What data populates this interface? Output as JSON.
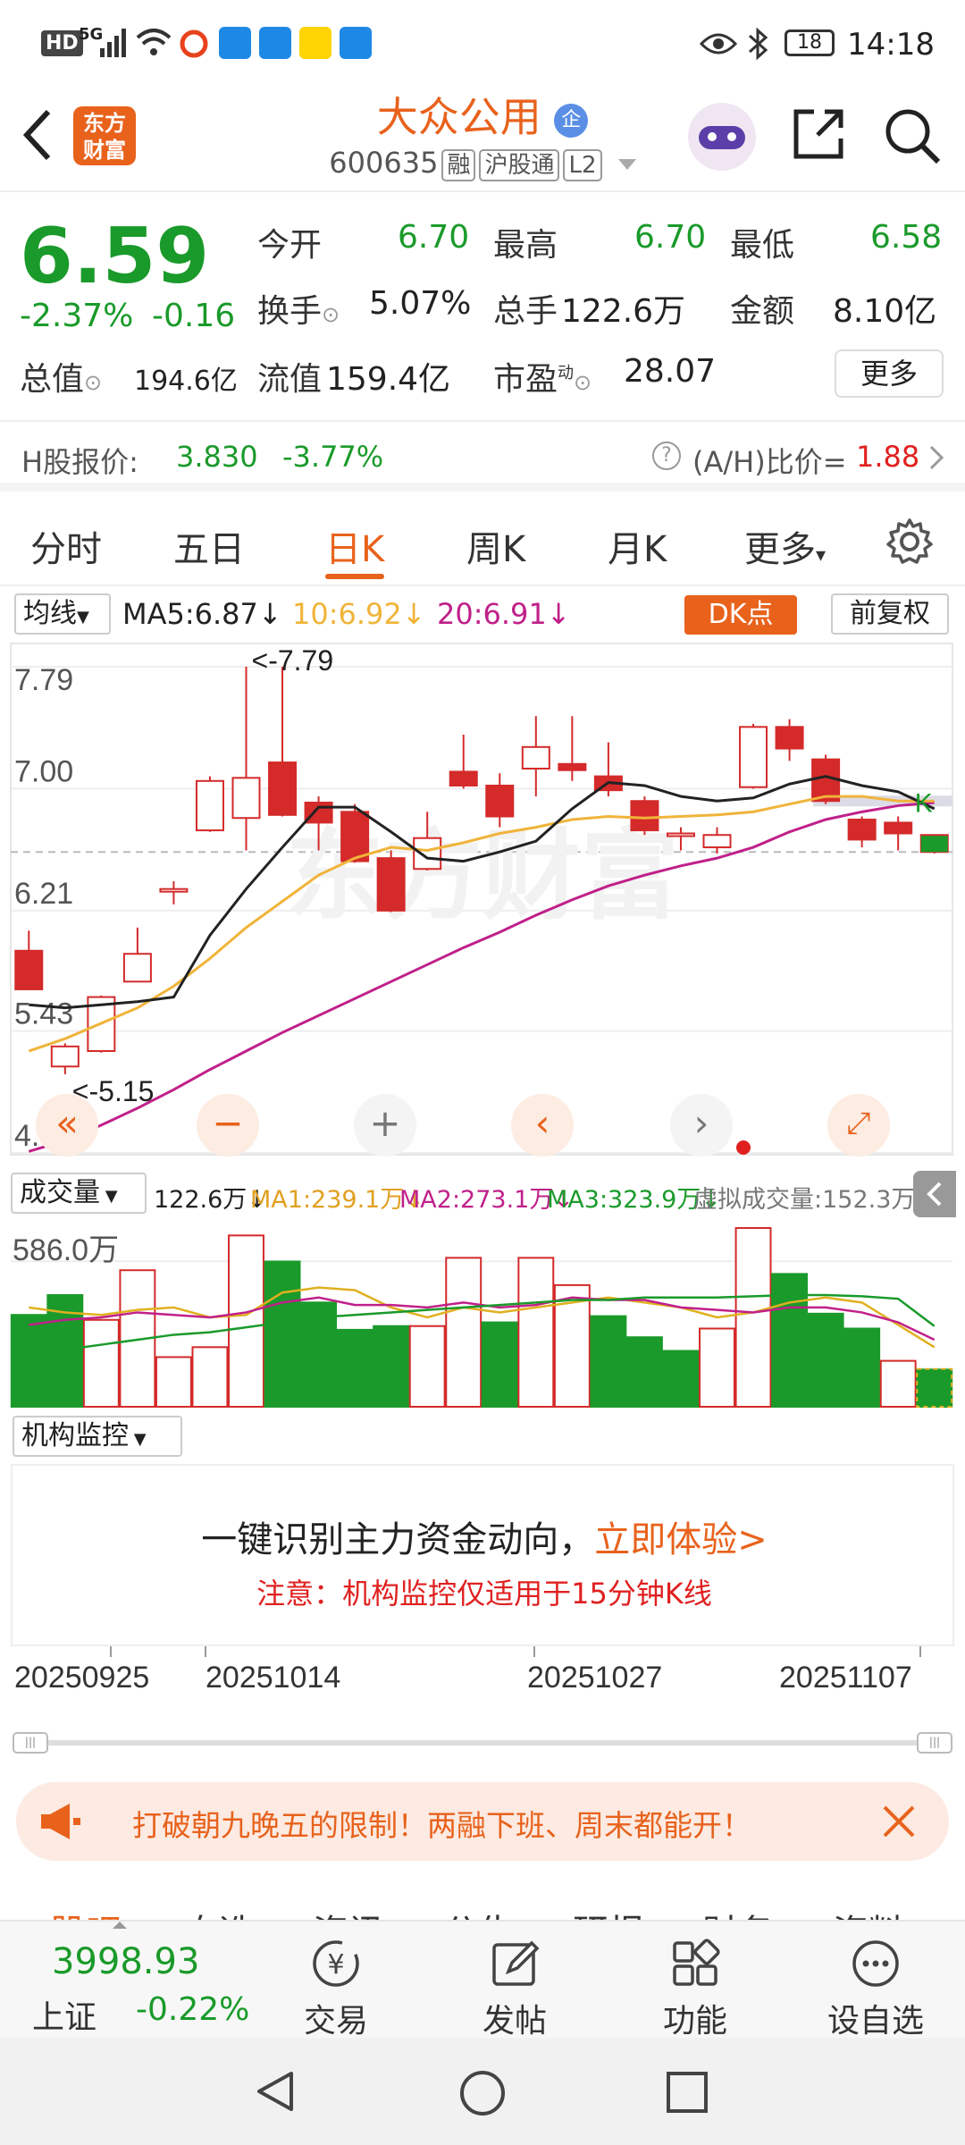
{
  "status_bar": {
    "left": "HD",
    "net": "5G",
    "battery": "18",
    "time": "14:18"
  },
  "header": {
    "logo_text": "东方\n财富",
    "stock_name": "大众公用",
    "enterprise_badge": "企",
    "code": "600635",
    "tags": [
      "融",
      "沪股通",
      "L2"
    ]
  },
  "quote": {
    "price": "6.59",
    "change_pct": "-2.37%",
    "change_abs": "-0.16",
    "open_label": "今开",
    "open": "6.70",
    "high_label": "最高",
    "high": "6.70",
    "low_label": "最低",
    "low": "6.58",
    "turnover_label": "换手",
    "turnover": "5.07%",
    "volume_label": "总手",
    "volume": "122.6万",
    "amount_label": "金额",
    "amount": "8.10亿",
    "mcap_label": "总值",
    "mcap": "194.6亿",
    "float_label": "流值",
    "float_cap": "159.4亿",
    "pe_label": "市盈",
    "pe_super": "动",
    "pe": "28.07",
    "more_button": "更多"
  },
  "hshare": {
    "label": "H股报价:",
    "price": "3.830",
    "change": "-3.77%",
    "ah_label": "(A/H)比价=",
    "ah_value": "1.88"
  },
  "tabs": [
    "分时",
    "五日",
    "日K",
    "周K",
    "月K",
    "更多"
  ],
  "active_tab": "日K",
  "ma_bar": {
    "selector": "均线",
    "ma5": "MA5:6.87",
    "ma10": "10:6.92",
    "ma20": "20:6.91",
    "dk_button": "DK点",
    "fq_button": "前复权"
  },
  "chart_data": {
    "type": "candlestick",
    "y_ticks": [
      "7.79",
      "7.00",
      "6.21",
      "5.43",
      "4.64"
    ],
    "ylim": [
      4.64,
      7.79
    ],
    "high_annotation": "<-7.79",
    "low_annotation": "<-5.15",
    "candles": [
      {
        "o": 5.95,
        "c": 5.7,
        "h": 6.08,
        "l": 5.7
      },
      {
        "o": 5.2,
        "c": 5.33,
        "h": 5.35,
        "l": 5.15
      },
      {
        "o": 5.3,
        "c": 5.65,
        "h": 5.66,
        "l": 5.29
      },
      {
        "o": 5.75,
        "c": 5.93,
        "h": 6.1,
        "l": 5.75
      },
      {
        "o": 6.35,
        "c": 6.35,
        "h": 6.4,
        "l": 6.25
      },
      {
        "o": 6.73,
        "c": 7.05,
        "h": 7.08,
        "l": 6.72
      },
      {
        "o": 6.81,
        "c": 7.07,
        "h": 7.79,
        "l": 6.6
      },
      {
        "o": 7.17,
        "c": 6.83,
        "h": 7.79,
        "l": 6.82
      },
      {
        "o": 6.91,
        "c": 6.78,
        "h": 6.95,
        "l": 6.6
      },
      {
        "o": 6.85,
        "c": 6.53,
        "h": 6.9,
        "l": 6.52
      },
      {
        "o": 6.55,
        "c": 6.21,
        "h": 6.6,
        "l": 6.2
      },
      {
        "o": 6.48,
        "c": 6.68,
        "h": 6.85,
        "l": 6.47
      },
      {
        "o": 7.11,
        "c": 7.02,
        "h": 7.35,
        "l": 7.0
      },
      {
        "o": 7.02,
        "c": 6.82,
        "h": 7.1,
        "l": 6.75
      },
      {
        "o": 7.13,
        "c": 7.27,
        "h": 7.47,
        "l": 6.95
      },
      {
        "o": 7.16,
        "c": 7.12,
        "h": 7.47,
        "l": 7.05
      },
      {
        "o": 7.08,
        "c": 6.99,
        "h": 7.3,
        "l": 6.95
      },
      {
        "o": 6.92,
        "c": 6.73,
        "h": 6.95,
        "l": 6.7
      },
      {
        "o": 6.7,
        "c": 6.71,
        "h": 6.75,
        "l": 6.6
      },
      {
        "o": 6.62,
        "c": 6.7,
        "h": 6.75,
        "l": 6.58
      },
      {
        "o": 7.01,
        "c": 7.4,
        "h": 7.42,
        "l": 7.0
      },
      {
        "o": 7.4,
        "c": 7.26,
        "h": 7.45,
        "l": 7.18
      },
      {
        "o": 7.19,
        "c": 6.92,
        "h": 7.22,
        "l": 6.9
      },
      {
        "o": 6.8,
        "c": 6.67,
        "h": 6.82,
        "l": 6.62
      },
      {
        "o": 6.78,
        "c": 6.71,
        "h": 6.82,
        "l": 6.6
      },
      {
        "o": 6.7,
        "c": 6.59,
        "h": 6.7,
        "l": 6.58
      }
    ],
    "ma5": [
      5.6,
      5.58,
      5.6,
      5.62,
      5.65,
      6.05,
      6.35,
      6.62,
      6.88,
      6.88,
      6.72,
      6.55,
      6.53,
      6.59,
      6.66,
      6.87,
      7.04,
      7.02,
      6.95,
      6.92,
      6.94,
      7.03,
      7.08,
      7.02,
      6.98,
      6.87
    ],
    "ma10": [
      5.3,
      5.38,
      5.48,
      5.58,
      5.72,
      5.9,
      6.1,
      6.27,
      6.44,
      6.55,
      6.62,
      6.6,
      6.65,
      6.71,
      6.75,
      6.8,
      6.82,
      6.81,
      6.82,
      6.83,
      6.85,
      6.9,
      6.95,
      6.95,
      6.92,
      6.92
    ],
    "ma20": [
      4.65,
      4.72,
      4.82,
      4.93,
      5.05,
      5.18,
      5.3,
      5.42,
      5.53,
      5.64,
      5.75,
      5.86,
      5.97,
      6.07,
      6.18,
      6.28,
      6.37,
      6.44,
      6.5,
      6.55,
      6.62,
      6.72,
      6.8,
      6.85,
      6.89,
      6.91
    ],
    "volume_label": "成交量",
    "volume_max_tick": "586.0万",
    "volume_legend": {
      "vol": "122.6万",
      "ma1": "MA1:239.1万",
      "ma2": "MA2:273.1万",
      "ma3": "MA3:323.9万",
      "virtual": "虚拟成交量:152.3万"
    },
    "volumes": [
      370,
      450,
      350,
      550,
      200,
      240,
      690,
      585,
      420,
      310,
      325,
      325,
      600,
      340,
      600,
      490,
      365,
      280,
      225,
      315,
      720,
      535,
      375,
      315,
      185,
      150
    ],
    "volume_up": [
      false,
      false,
      true,
      true,
      true,
      true,
      true,
      false,
      false,
      false,
      false,
      true,
      true,
      false,
      true,
      true,
      false,
      false,
      false,
      true,
      true,
      false,
      false,
      false,
      true,
      false
    ],
    "vol_ma1": [
      400,
      380,
      370,
      390,
      400,
      360,
      370,
      460,
      480,
      470,
      400,
      360,
      400,
      380,
      400,
      420,
      440,
      420,
      400,
      360,
      380,
      420,
      440,
      420,
      330,
      240
    ],
    "vol_ma2": [
      330,
      350,
      360,
      380,
      370,
      360,
      380,
      420,
      440,
      410,
      410,
      400,
      420,
      400,
      410,
      440,
      430,
      430,
      400,
      390,
      380,
      400,
      400,
      380,
      340,
      270
    ],
    "vol_ma3": [
      210,
      230,
      250,
      270,
      290,
      300,
      320,
      340,
      360,
      370,
      380,
      390,
      400,
      410,
      420,
      430,
      430,
      440,
      440,
      440,
      445,
      450,
      450,
      445,
      435,
      325
    ],
    "x_labels": [
      "20250925",
      "20251014",
      "20251027",
      "20251107"
    ]
  },
  "institution": {
    "selector": "机构监控",
    "headline": "一键识别主力资金动向，",
    "cta": "立即体验>",
    "note": "注意：机构监控仅适用于15分钟K线"
  },
  "banner": {
    "text": "打破朝九晚五的限制！两融下班、周末都能开！"
  },
  "subtabs_partial": [
    "股吧",
    "自选",
    "资讯",
    "公告",
    "研报",
    "财务",
    "资料"
  ],
  "bottom_nav": {
    "index_value": "3998.93",
    "index_name": "上证",
    "index_change": "-0.22%",
    "items": [
      "交易",
      "发帖",
      "功能",
      "设自选"
    ]
  },
  "colors": {
    "up": "#d42a2a",
    "down": "#1a9a2a",
    "ma5": "#222222",
    "ma10": "#f0b43a",
    "ma20": "#c0208a",
    "accent": "#e8621c"
  }
}
